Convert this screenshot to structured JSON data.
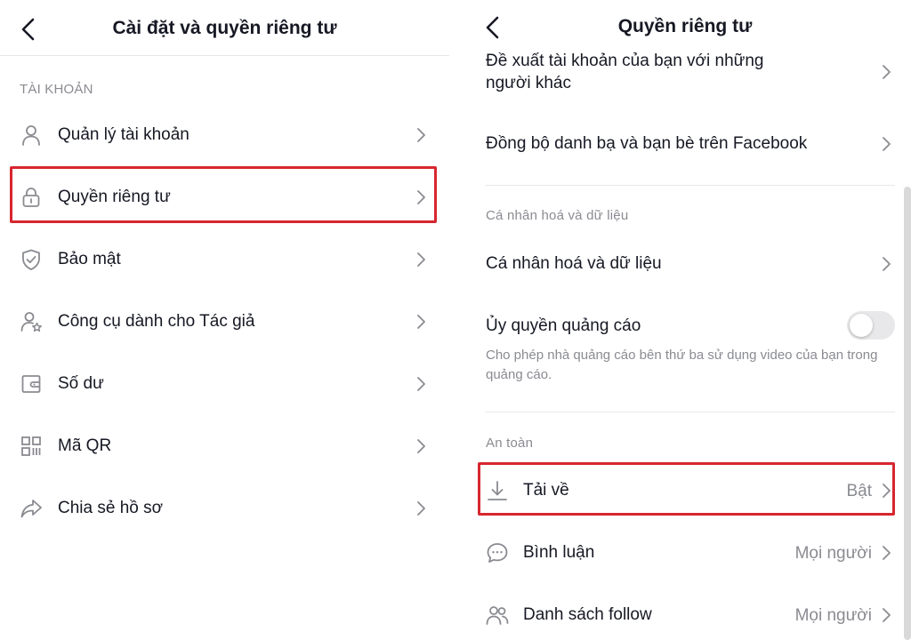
{
  "left": {
    "title": "Cài đặt và quyền riêng tư",
    "section_label": "TÀI KHOẢN",
    "items": [
      {
        "label": "Quản lý tài khoản",
        "icon": "person-icon"
      },
      {
        "label": "Quyền riêng tư",
        "icon": "lock-icon"
      },
      {
        "label": "Bảo mật",
        "icon": "shield-check-icon"
      },
      {
        "label": "Công cụ dành cho Tác giả",
        "icon": "person-star-icon"
      },
      {
        "label": "Số dư",
        "icon": "wallet-icon"
      },
      {
        "label": "Mã QR",
        "icon": "qr-code-icon"
      },
      {
        "label": "Chia sẻ hồ sơ",
        "icon": "share-arrow-icon"
      }
    ],
    "highlighted_item": "Quyền riêng tư"
  },
  "right": {
    "title": "Quyền riêng tư",
    "suggest_line1": "Đề xuất tài khoản của bạn với những",
    "suggest_line2": "người khác",
    "sync_label": "Đồng bộ danh bạ và bạn bè trên Facebook",
    "personalization_section": "Cá nhân hoá và dữ liệu",
    "personalization_item": "Cá nhân hoá và dữ liệu",
    "ad_auth_label": "Ủy quyền quảng cáo",
    "ad_auth_enabled": false,
    "ad_auth_desc": "Cho phép nhà quảng cáo bên thứ ba sử dụng video của bạn trong quảng cáo.",
    "safety_section": "An toàn",
    "download_label": "Tải về",
    "download_value": "Bật",
    "comments_label": "Bình luận",
    "comments_value": "Mọi người",
    "follow_list_label": "Danh sách follow",
    "follow_list_value": "Mọi người"
  },
  "colors": {
    "highlight": "#d7262f",
    "text_primary": "#161823",
    "text_secondary": "#8a8b91"
  }
}
